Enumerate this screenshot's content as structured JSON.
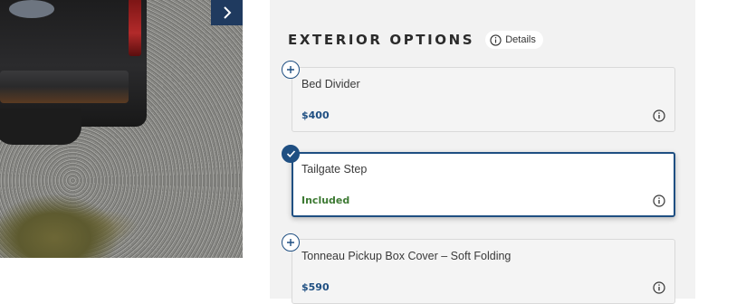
{
  "gallery": {
    "next_icon": "chevron-right-icon"
  },
  "options": {
    "heading": "EXTERIOR OPTIONS",
    "details_label": "Details",
    "details_icon": "info-icon",
    "items": [
      {
        "name": "Bed Divider",
        "price": "$400",
        "selected": false,
        "badge_icon": "plus-icon"
      },
      {
        "name": "Tailgate Step",
        "price": "Included",
        "selected": true,
        "badge_icon": "check-icon"
      },
      {
        "name": "Tonneau Pickup Box Cover – Soft Folding",
        "price": "$590",
        "selected": false,
        "badge_icon": "plus-icon"
      }
    ]
  },
  "colors": {
    "accent": "#1f4f82",
    "included": "#3d7a33",
    "panel_bg": "#f2f2f2"
  }
}
